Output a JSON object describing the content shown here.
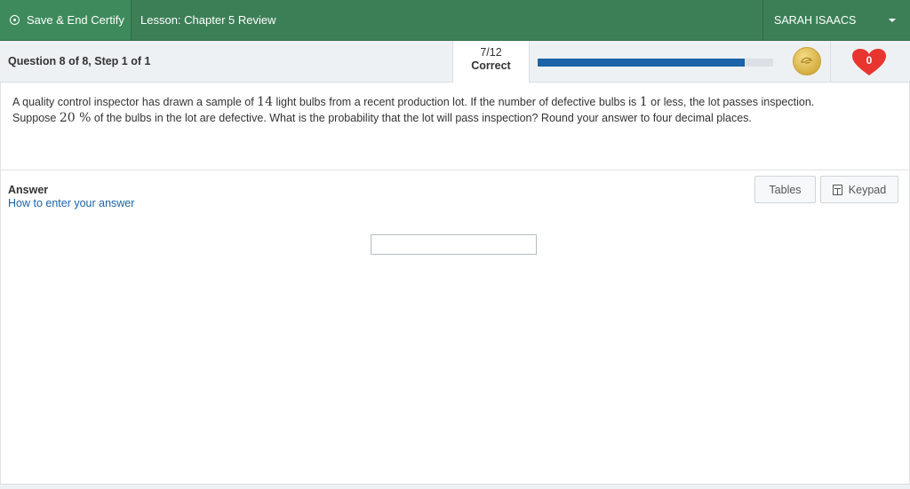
{
  "topbar": {
    "save_label": "Save & End Certify",
    "lesson_label": "Lesson: Chapter 5 Review",
    "user_name": "SARAH ISAACS"
  },
  "status": {
    "question_title": "Question 8 of 8, Step 1 of 1",
    "score_fraction": "7/12",
    "score_label": "Correct",
    "progress_fraction": 0.88,
    "hearts": "0"
  },
  "question": {
    "line1_a": "A quality control inspector has drawn a sample of ",
    "sample_size": "14",
    "line1_b": " light bulbs from a recent production lot. If the number of defective bulbs is ",
    "threshold": "1",
    "line1_c": " or less, the lot passes inspection.",
    "line2_a": "Suppose ",
    "percent": "20 %",
    "line2_b": " of the bulbs in the lot are defective. What is the probability that the lot will pass inspection? Round your answer to four decimal places."
  },
  "answer": {
    "label": "Answer",
    "help_link": "How to enter your answer",
    "tables_label": "Tables",
    "keypad_label": "Keypad",
    "value": ""
  },
  "colors": {
    "header_green": "#3c7f57",
    "progress_blue": "#1a63a8",
    "heart_red": "#e8352f",
    "link_blue": "#1a63a8"
  },
  "icons": {
    "save": "circle-dot-icon",
    "user_menu": "caret-down-icon",
    "coin": "coin-icon",
    "heart": "heart-icon",
    "keypad": "calculator-icon"
  }
}
